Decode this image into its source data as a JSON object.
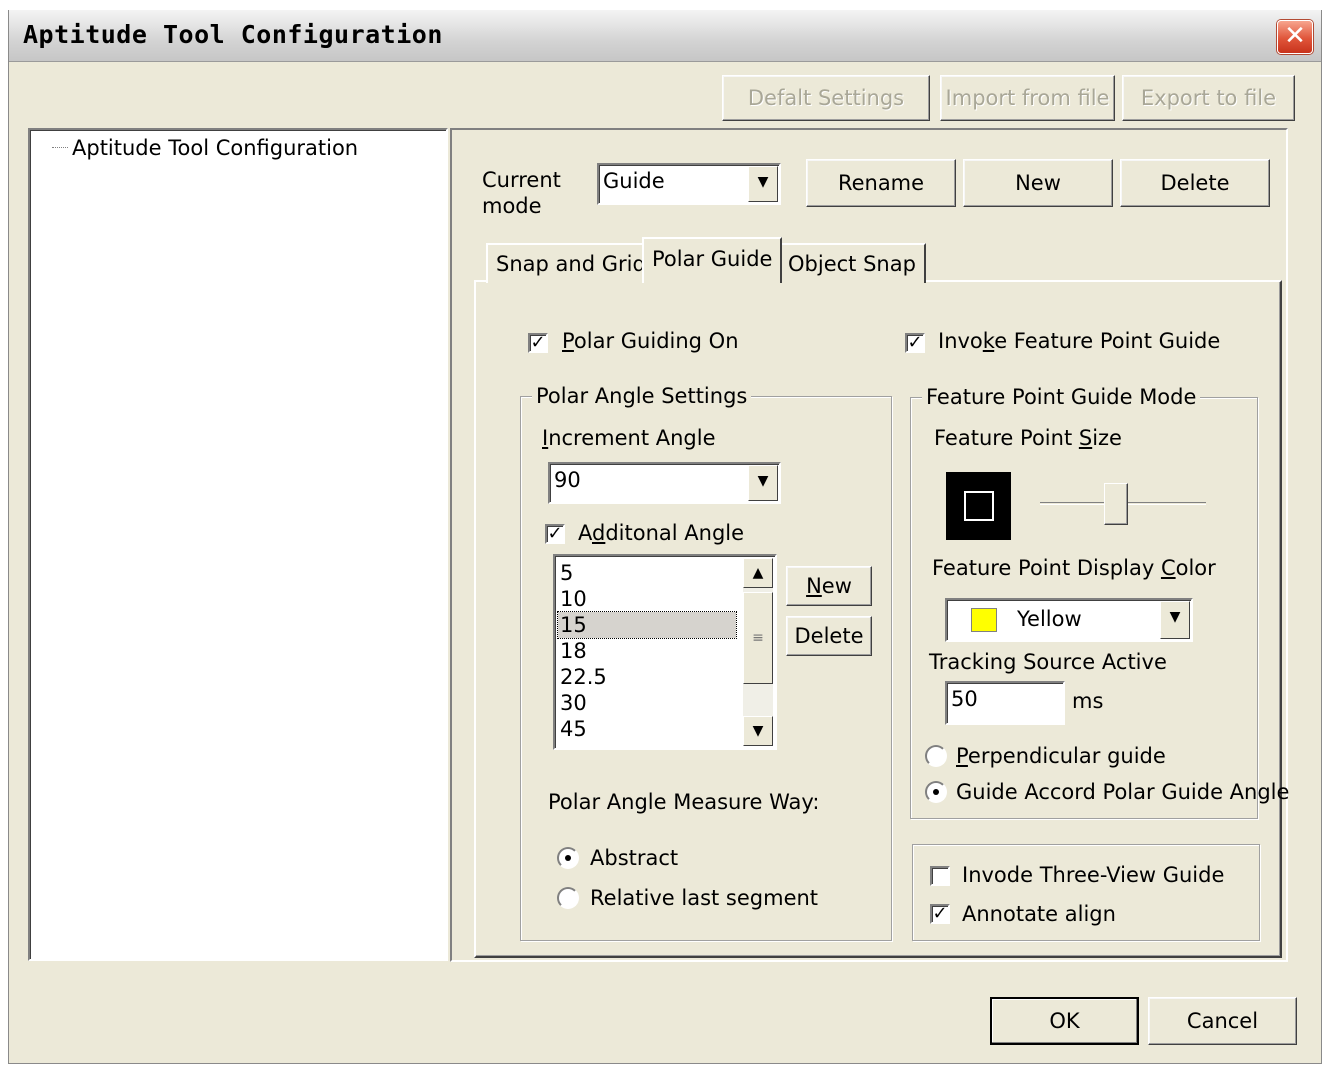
{
  "window": {
    "title": "Aptitude Tool Configuration"
  },
  "toolbar": {
    "default_settings": "Defalt Settings",
    "import": "Import from file",
    "export": "Export to file"
  },
  "tree": {
    "root": "Aptitude Tool Configuration"
  },
  "mode": {
    "label_line1": "Current",
    "label_line2": "mode",
    "value": "Guide",
    "rename": "Rename",
    "new": "New",
    "delete": "Delete"
  },
  "tabs": [
    {
      "label": "Snap and Grid",
      "active": false
    },
    {
      "label": "Polar Guide",
      "active": true
    },
    {
      "label": "Object Snap",
      "active": false
    }
  ],
  "polar": {
    "on_prefix": "",
    "on_u": "P",
    "on_rest": "olar Guiding On",
    "on_checked": true,
    "settings_title": "Polar Angle Settings",
    "increment_u": "I",
    "increment_rest": "ncrement Angle",
    "increment_value": "90",
    "additional_prefix": "A",
    "additional_u": "d",
    "additional_rest": "ditonal Angle",
    "additional_checked": true,
    "angles": [
      "5",
      "10",
      "15",
      "18",
      "22.5",
      "30",
      "45"
    ],
    "selected_angle": "15",
    "new_u": "N",
    "new_rest": "ew",
    "delete": "Delete",
    "measure_label": "Polar Angle Measure Way:",
    "abstract": "Abstract",
    "relative": "Relative last segment"
  },
  "feature": {
    "invoke_prefix": "Invo",
    "invoke_u": "k",
    "invoke_rest": "e Feature Point Guide",
    "invoke_checked": true,
    "mode_title": "Feature Point Guide Mode",
    "size_prefix": "Feature Point ",
    "size_u": "S",
    "size_rest": "ize",
    "size_level": 0.5,
    "color_prefix": "Feature Point Display ",
    "color_u": "C",
    "color_rest": "olor",
    "color_value": "Yellow",
    "swatch_color": "#ffff00",
    "tracking_label": "Tracking Source Active",
    "tracking_value": "50",
    "tracking_unit": "ms",
    "perp_u": "P",
    "perp_rest": "erpendicular guide",
    "accord": "Guide Accord Polar Guide Angle"
  },
  "extras": {
    "three_view": "Invode Three-View Guide",
    "three_view_checked": false,
    "annotate": "Annotate align",
    "annotate_checked": true
  },
  "footer": {
    "ok": "OK",
    "cancel": "Cancel"
  }
}
